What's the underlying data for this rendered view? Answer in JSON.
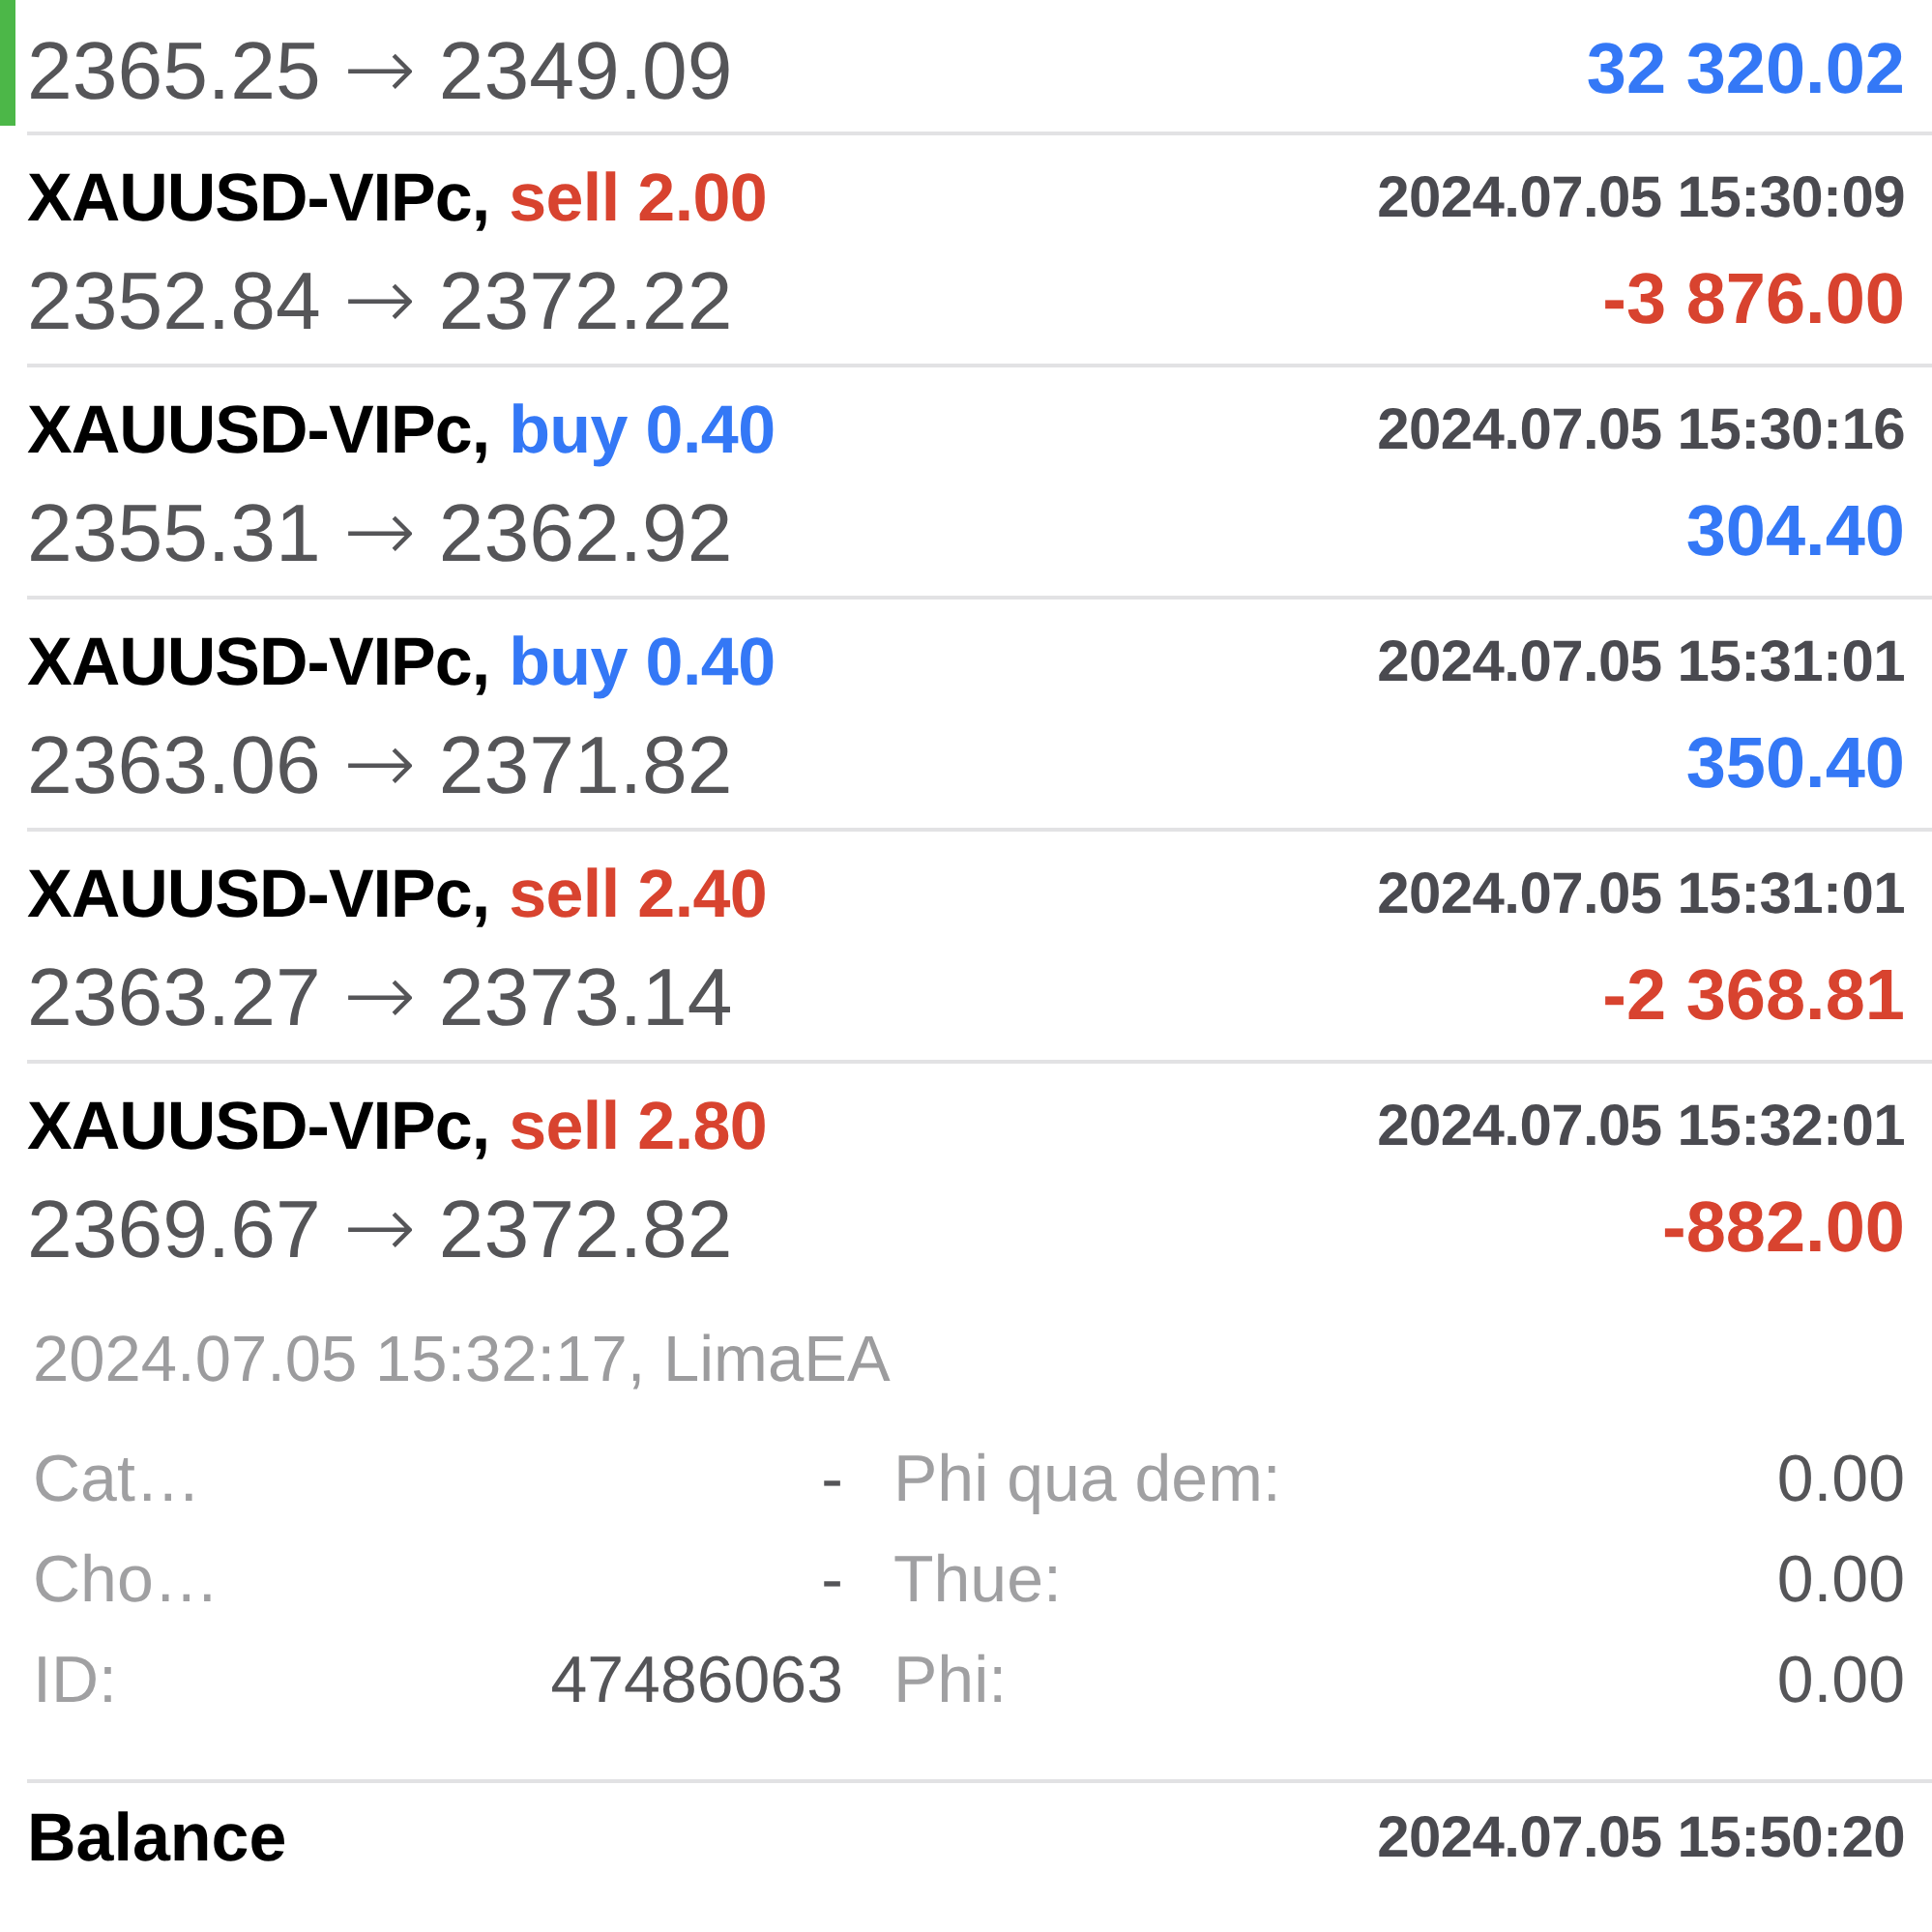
{
  "trades": [
    {
      "highlighted": true,
      "prices": "2365.25 → 2349.09",
      "profit": "32 320.02",
      "loss": false
    },
    {
      "highlighted": false,
      "symbol": "XAUUSD-VIPc,",
      "order": "sell 2.00",
      "kind": "sell",
      "time": "2024.07.05 15:30:09",
      "prices": "2352.84 → 2372.22",
      "profit": "-3 876.00",
      "loss": true
    },
    {
      "highlighted": false,
      "symbol": "XAUUSD-VIPc,",
      "order": "buy 0.40",
      "kind": "buy",
      "time": "2024.07.05 15:30:16",
      "prices": "2355.31 → 2362.92",
      "profit": "304.40",
      "loss": false
    },
    {
      "highlighted": false,
      "symbol": "XAUUSD-VIPc,",
      "order": "buy 0.40",
      "kind": "buy",
      "time": "2024.07.05 15:31:01",
      "prices": "2363.06 → 2371.82",
      "profit": "350.40",
      "loss": false
    },
    {
      "highlighted": false,
      "symbol": "XAUUSD-VIPc,",
      "order": "sell 2.40",
      "kind": "sell",
      "time": "2024.07.05 15:31:01",
      "prices": "2363.27 → 2373.14",
      "profit": "-2 368.81",
      "loss": true
    },
    {
      "highlighted": false,
      "symbol": "XAUUSD-VIPc,",
      "order": "sell 2.80",
      "kind": "sell",
      "time": "2024.07.05 15:32:01",
      "prices": "2369.67 → 2372.82",
      "profit": "-882.00",
      "loss": true,
      "details": {
        "header": "2024.07.05 15:32:17, LimaEA",
        "rows": [
          {
            "cells": [
              "Cat…",
              "-",
              "Phi qua dem:",
              "0.00"
            ]
          },
          {
            "cells": [
              "Cho…",
              "-",
              "Thue:",
              "0.00"
            ]
          },
          {
            "cells": [
              "ID:",
              "47486063",
              "Phi:",
              "0.00"
            ]
          }
        ]
      }
    }
  ],
  "balance": {
    "title": "Balance",
    "time": "2024.07.05 15:50:20"
  }
}
